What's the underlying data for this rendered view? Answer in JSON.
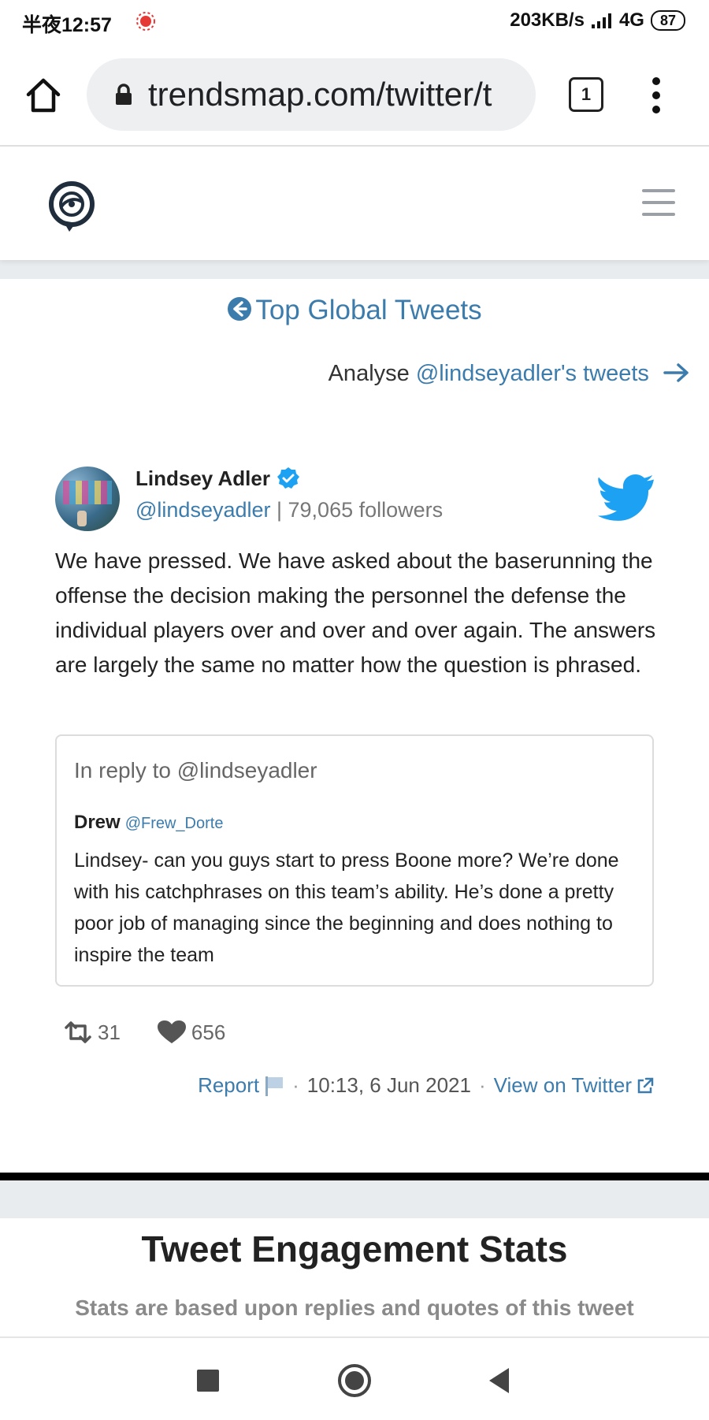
{
  "status_bar": {
    "time": "半夜12:57",
    "speed": "203KB/s",
    "network": "4G",
    "battery": "87"
  },
  "browser": {
    "url": "trendsmap.com/twitter/t",
    "tab_count": "1"
  },
  "page": {
    "top_link": "Top Global Tweets",
    "analyse_prefix": "Analyse ",
    "analyse_link": "@lindseyadler's tweets"
  },
  "tweet": {
    "author_name": "Lindsey Adler",
    "author_handle": "@lindseyadler",
    "followers": " | 79,065 followers",
    "text": "We have pressed. We have asked about the baserunning the offense the decision making the personnel the defense the individual players over and over and over again. The answers are largely the same no matter how the question is phrased.",
    "reply": {
      "in_reply_to": "In reply to @lindseyadler",
      "name": "Drew",
      "handle": "@Frew_Dorte",
      "text": "Lindsey- can you guys start to press Boone more? We’re done with his catchphrases on this team’s ability. He’s done a pretty poor job of managing since the beginning and does nothing to inspire the team"
    },
    "retweets": "31",
    "likes": "656",
    "report_label": "Report",
    "timestamp": "10:13, 6 Jun 2021",
    "view_on_twitter": "View on Twitter"
  },
  "engagement": {
    "title": "Tweet Engagement Stats",
    "subtitle": "Stats are based upon replies and quotes of this tweet"
  },
  "colors": {
    "link": "#3c7cad",
    "twitter_blue": "#1da1f2"
  }
}
